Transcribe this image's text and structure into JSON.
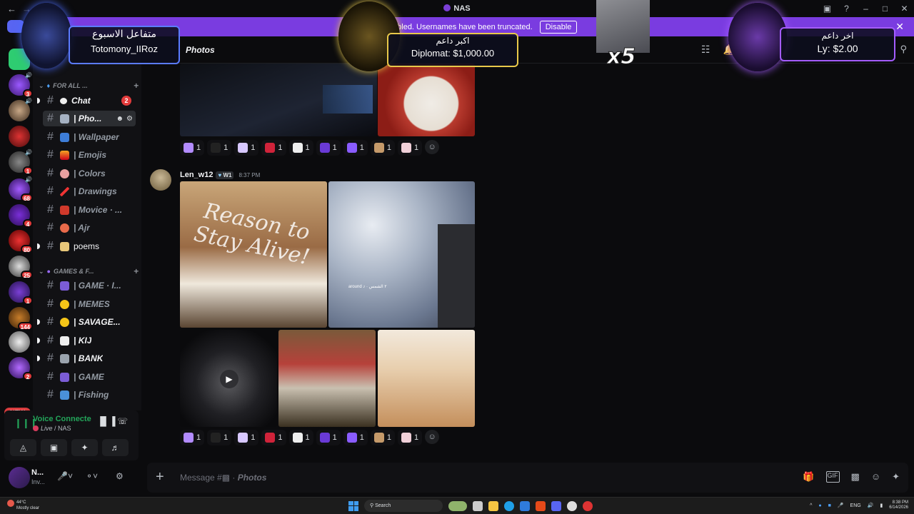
{
  "window": {
    "title": "NAS"
  },
  "banner": {
    "text": "e is enabled. Usernames have been truncated.",
    "disable_label": "Disable"
  },
  "header": {
    "channel": "Photos"
  },
  "servers": [
    {
      "badge": ""
    },
    {
      "badge": "3"
    },
    {
      "badge": ""
    },
    {
      "badge": ""
    },
    {
      "badge": "1"
    },
    {
      "badge": "68"
    },
    {
      "badge": "4"
    },
    {
      "badge": "80"
    },
    {
      "badge": "25"
    },
    {
      "badge": "1"
    },
    {
      "badge": "144"
    },
    {
      "badge": ""
    },
    {
      "badge": "2"
    }
  ],
  "new_label": "NEW",
  "categories": [
    {
      "label": "FOR ALL ..."
    },
    {
      "label": "GAMES & F..."
    }
  ],
  "channels": [
    {
      "name": "Chat",
      "count": "2"
    },
    {
      "name": "| Pho..."
    },
    {
      "name": "| Wallpaper"
    },
    {
      "name": "| Emojis"
    },
    {
      "name": "| Colors"
    },
    {
      "name": "| Drawings"
    },
    {
      "name": "| Movice · ..."
    },
    {
      "name": "| Ajr"
    },
    {
      "name": "poems"
    },
    {
      "name": "| GAME · I..."
    },
    {
      "name": "| MEMES"
    },
    {
      "name": "| SAVAGE..."
    },
    {
      "name": "| KIJ"
    },
    {
      "name": "| BANK"
    },
    {
      "name": "| GAME"
    },
    {
      "name": "| Fishing"
    }
  ],
  "voice": {
    "status": "Voice Connecte",
    "sub_live": "Live",
    "sub_server": "/ NAS"
  },
  "user": {
    "name": "N...",
    "status": "Inv..."
  },
  "message": {
    "author": "Len_w12",
    "tag": "W1",
    "time": "8:37 PM"
  },
  "reactions": [
    "1",
    "1",
    "1",
    "1",
    "1",
    "1",
    "1",
    "1",
    "1"
  ],
  "image_text": {
    "handwriting": "Reason to Stay Alive!",
    "sky_caption": "around ♪ · ٢ الشمس"
  },
  "composer": {
    "placeholder_prefix": "Message #",
    "placeholder_channel": "Photos"
  },
  "overlays": {
    "left": {
      "ar": "متفاعل الاسبوع",
      "name": "Totomony_IIRoz"
    },
    "center": {
      "ar": "اكبر داعم",
      "value": "Diplomat: $1,000.00"
    },
    "right": {
      "ar": "اخر داعم",
      "value": "Ly: $2.00"
    },
    "multiplier": "x5"
  },
  "taskbar": {
    "temp": "44°C",
    "weather": "Mostly clear",
    "search": "Search",
    "lang": "ENG",
    "time": "8:38 PM",
    "date": "6/14/2026"
  },
  "colors": {
    "accent": "#7a3ce0",
    "online": "#23a55a",
    "badge": "#e23b3b"
  }
}
